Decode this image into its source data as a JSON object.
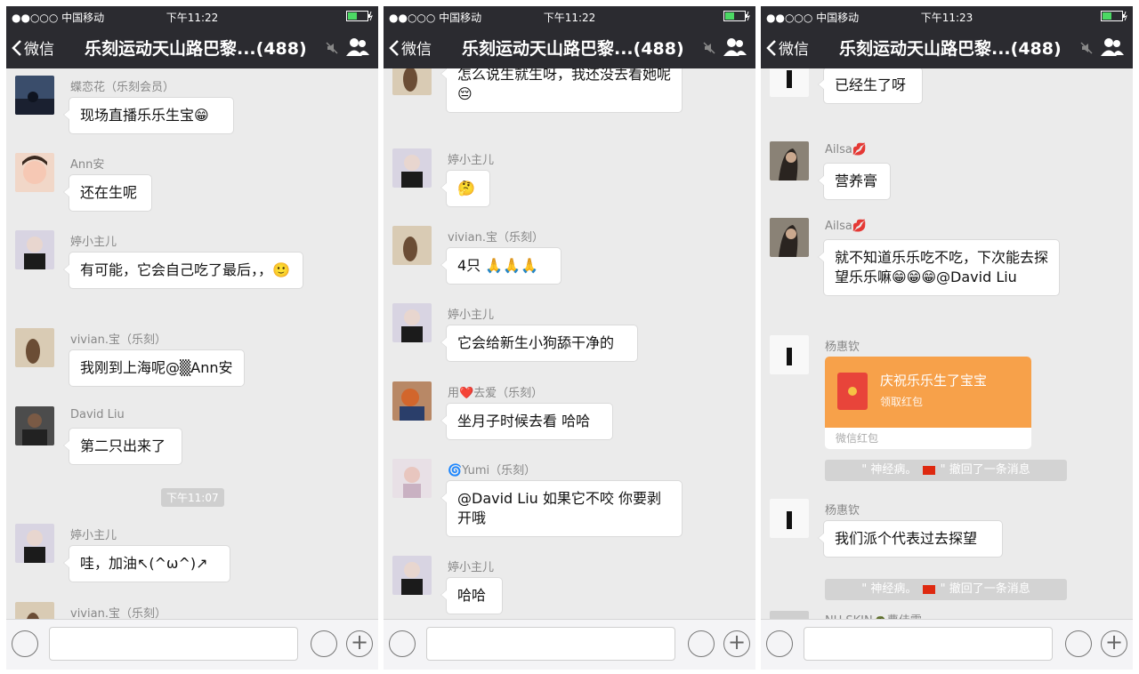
{
  "status": {
    "carrier": "●●○○○ 中国移动",
    "times": [
      "下午11:22",
      "下午11:22",
      "下午11:23"
    ]
  },
  "nav": {
    "back_label": "微信",
    "chat_title": "乐刻运动天山路巴黎...(488)"
  },
  "panel1": {
    "messages": [
      {
        "sender": "蝶恋花（乐刻会员）",
        "text": "现场直播乐乐生宝😁"
      },
      {
        "sender": "Ann安",
        "text": "还在生呢"
      },
      {
        "sender": "婷小主儿",
        "text": "有可能，它会自己吃了最后，，🙂"
      },
      {
        "sender": "vivian.宝（乐刻）",
        "text": "我刚到上海呢@▒Ann安"
      },
      {
        "sender": "David Liu",
        "text": "第二只出来了"
      },
      {
        "sender": "婷小主儿",
        "text": "哇，加油↖(^ω^)↗"
      },
      {
        "sender": "vivian.宝（乐刻）",
        "text": ""
      }
    ],
    "timestamp": "下午11:07"
  },
  "panel2": {
    "messages": [
      {
        "sender": "",
        "text": "怎么说生就生呀，我还没去看她呢😔"
      },
      {
        "sender": "婷小主儿",
        "text": "🤔"
      },
      {
        "sender": "vivian.宝（乐刻）",
        "text": "4只 🙏🙏🙏"
      },
      {
        "sender": "婷小主儿",
        "text": "它会给新生小狗舔干净的"
      },
      {
        "sender": "用❤️去爱（乐刻）",
        "text": "坐月子时候去看 哈哈"
      },
      {
        "sender": "🌀Yumi（乐刻）",
        "text": "@David Liu 如果它不咬 你要剥开哦"
      },
      {
        "sender": "婷小主儿",
        "text": "哈哈"
      }
    ]
  },
  "panel3": {
    "messages": [
      {
        "sender": "杨惠钦",
        "text": "已经生了呀"
      },
      {
        "sender": "Ailsa💋",
        "text": "营养膏"
      },
      {
        "sender": "Ailsa💋",
        "text": "就不知道乐乐吃不吃，下次能去探望乐乐嘛😁😁😁@David Liu"
      },
      {
        "sender": "杨惠钦",
        "text": ""
      },
      {
        "sender": "杨惠钦",
        "text": "我们派个代表过去探望"
      },
      {
        "sender": "NU SKIN🐢曹佳雯",
        "text": ""
      }
    ],
    "red_packet": {
      "title": "庆祝乐乐生了宝宝",
      "subtitle": "领取红包",
      "footer": "微信红包"
    },
    "recall_notice": {
      "name": "神经病。",
      "suffix": "\" 撤回了一条消息",
      "quote_open": "\""
    }
  },
  "colors": {
    "header": "#2b2b30",
    "background": "#ebebeb",
    "red_packet": "#f7a14a"
  }
}
